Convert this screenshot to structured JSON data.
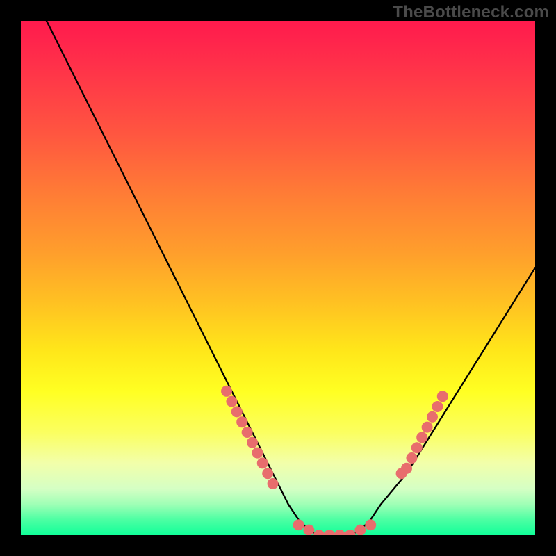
{
  "watermark": "TheBottleneck.com",
  "chart_data": {
    "type": "line",
    "title": "",
    "xlabel": "",
    "ylabel": "",
    "xlim": [
      0,
      100
    ],
    "ylim": [
      0,
      100
    ],
    "grid": false,
    "legend": false,
    "annotations": [],
    "series": [
      {
        "name": "bottleneck-curve",
        "x": [
          5,
          10,
          15,
          20,
          25,
          30,
          35,
          40,
          45,
          50,
          52,
          54,
          56,
          58,
          60,
          62,
          64,
          66,
          68,
          70,
          75,
          80,
          85,
          90,
          95,
          100
        ],
        "values": [
          100,
          90,
          80,
          70,
          60,
          50,
          40,
          30,
          20,
          10,
          6,
          3,
          1,
          0,
          0,
          0,
          0,
          1,
          3,
          6,
          12,
          20,
          28,
          36,
          44,
          52
        ]
      },
      {
        "name": "left-marker-band",
        "x": [
          40,
          41,
          42,
          43,
          44,
          45,
          46,
          47,
          48,
          49
        ],
        "values": [
          28,
          26,
          24,
          22,
          20,
          18,
          16,
          14,
          12,
          10
        ]
      },
      {
        "name": "bottom-marker-band",
        "x": [
          54,
          56,
          58,
          60,
          62,
          64,
          66,
          68
        ],
        "values": [
          2,
          1,
          0,
          0,
          0,
          0,
          1,
          2
        ]
      },
      {
        "name": "right-marker-band",
        "x": [
          74,
          75,
          76,
          77,
          78,
          79,
          80,
          81,
          82
        ],
        "values": [
          12,
          13,
          15,
          17,
          19,
          21,
          23,
          25,
          27
        ]
      }
    ],
    "colors": {
      "curve": "#000000",
      "markers": "#e86d6d",
      "gradient_top": "#ff1a4d",
      "gradient_bottom": "#10ff99"
    }
  }
}
